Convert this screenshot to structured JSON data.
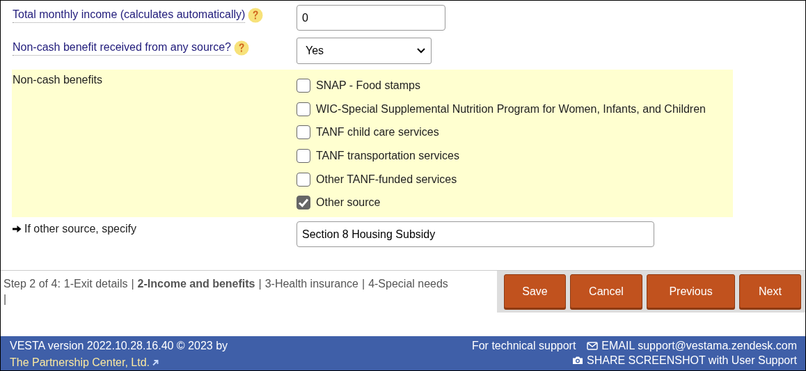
{
  "fields": [
    {
      "kind": "text",
      "label": "Total monthly income (calculates automatically)",
      "help": true,
      "value": "0"
    },
    {
      "kind": "select",
      "label": "Non-cash benefit received from any source?",
      "help": true,
      "value": "Yes"
    }
  ],
  "benefits": {
    "label": "Non-cash benefits",
    "options": [
      {
        "label": "SNAP - Food stamps",
        "checked": false
      },
      {
        "label": "WIC-Special Supplemental Nutrition Program for Women, Infants, and Children",
        "checked": false
      },
      {
        "label": "TANF child care services",
        "checked": false
      },
      {
        "label": "TANF transportation services",
        "checked": false
      },
      {
        "label": "Other TANF-funded services",
        "checked": false
      },
      {
        "label": "Other source",
        "checked": true
      }
    ]
  },
  "other_source": {
    "label": "If other source, specify",
    "value": "Section 8 Housing Subsidy"
  },
  "steps": {
    "prefix": "Step 2 of 4:",
    "separator": "|",
    "items": [
      {
        "label": "1-Exit details",
        "selected": false
      },
      {
        "label": "2-Income and benefits",
        "selected": true
      },
      {
        "label": "3-Health insurance",
        "selected": false
      },
      {
        "label": "4-Special needs",
        "selected": false
      }
    ]
  },
  "buttons": [
    "Save",
    "Cancel",
    "Previous",
    "Next"
  ],
  "footer": {
    "version": "VESTA version 2022.10.28.16.40 © 2023 by",
    "company_link": "The Partnership Center, Ltd.",
    "support_label": "For technical support",
    "email_link": "EMAIL support@vestama.zendesk.com",
    "share_link": "SHARE SCREENSHOT with User Support"
  }
}
